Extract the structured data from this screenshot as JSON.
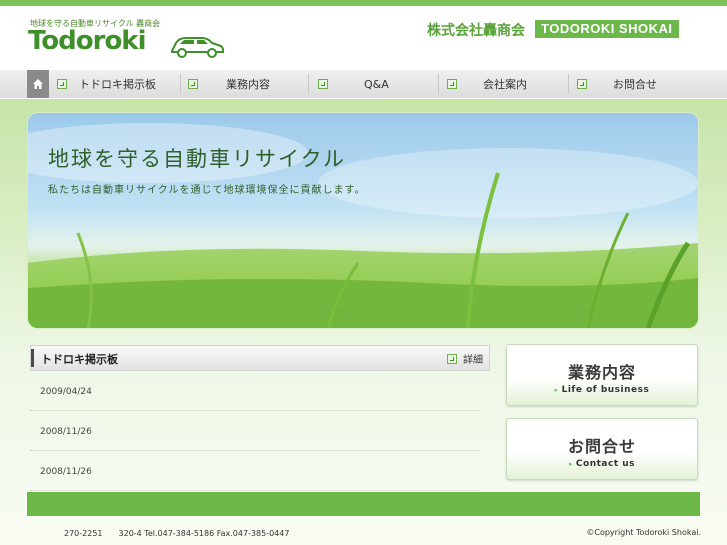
{
  "header": {
    "tagline": "地球を守る自動車リサイクル 轟商会",
    "logo": "Todoroki",
    "company_jp": "株式会社轟商会",
    "company_en": "TODOROKI SHOKAI"
  },
  "nav": {
    "items": [
      {
        "label": "トドロキ掲示板"
      },
      {
        "label": "業務内容"
      },
      {
        "label": "Q&A"
      },
      {
        "label": "会社案内"
      },
      {
        "label": "お問合せ"
      }
    ]
  },
  "hero": {
    "title": "地球を守る自動車リサイクル",
    "subtitle": "私たちは自動車リサイクルを通じて地球環境保全に貢献します。"
  },
  "board": {
    "title": "トドロキ掲示板",
    "more_label": "詳細",
    "rows": [
      {
        "date": "2009/04/24"
      },
      {
        "date": "2008/11/26"
      },
      {
        "date": "2008/11/26"
      }
    ]
  },
  "side": {
    "business": {
      "title": "業務内容",
      "sub": "Life of business"
    },
    "contact": {
      "title": "お問合せ",
      "sub": "Contact us"
    }
  },
  "footer": {
    "address": "270-2251　　320-4 Tel.047-384-5186 Fax.047-385-0447",
    "copyright": "©Copyright Todoroki Shokai."
  },
  "colors": {
    "accent": "#6cb84a",
    "nav_bg": "#e6e6e6"
  }
}
